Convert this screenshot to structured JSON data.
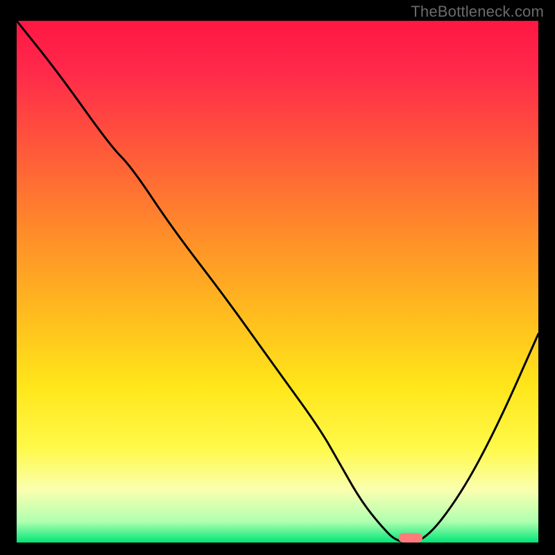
{
  "watermark": "TheBottleneck.com",
  "chart_data": {
    "type": "line",
    "title": "",
    "xlabel": "",
    "ylabel": "",
    "xlim": [
      0,
      100
    ],
    "ylim": [
      0,
      100
    ],
    "grid": false,
    "gradient_stops": [
      {
        "offset": 0.0,
        "color": "#ff1744"
      },
      {
        "offset": 0.1,
        "color": "#ff2a4a"
      },
      {
        "offset": 0.25,
        "color": "#ff5a3a"
      },
      {
        "offset": 0.4,
        "color": "#ff8a2a"
      },
      {
        "offset": 0.55,
        "color": "#ffb81f"
      },
      {
        "offset": 0.7,
        "color": "#ffe61a"
      },
      {
        "offset": 0.82,
        "color": "#fff94a"
      },
      {
        "offset": 0.9,
        "color": "#faffb0"
      },
      {
        "offset": 0.96,
        "color": "#b0ffb0"
      },
      {
        "offset": 1.0,
        "color": "#00e676"
      }
    ],
    "series": [
      {
        "name": "bottleneck-curve",
        "x": [
          0,
          8,
          18,
          22,
          30,
          40,
          50,
          58,
          62,
          66,
          70,
          73,
          78,
          85,
          92,
          100
        ],
        "values": [
          100,
          90,
          76,
          72,
          60,
          47,
          33,
          22,
          15,
          8,
          3,
          0,
          0,
          9,
          22,
          40
        ]
      }
    ],
    "marker": {
      "name": "optimal-point",
      "x": 75.5,
      "y": 0,
      "width_pct": 4.6,
      "height_pct": 1.8,
      "color": "#ff7b7b"
    }
  }
}
